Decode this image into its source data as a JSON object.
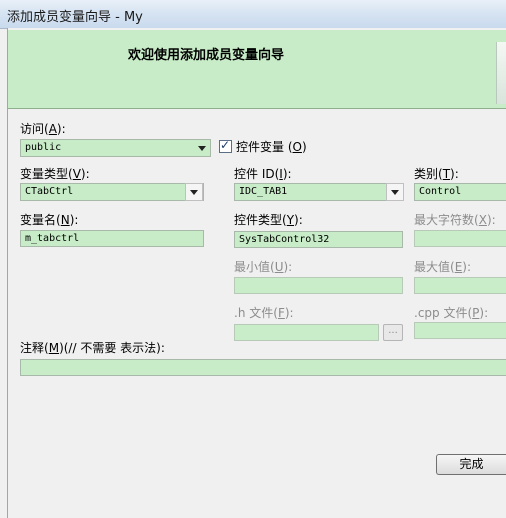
{
  "window": {
    "title": "添加成员变量向导 - My"
  },
  "banner": {
    "heading": "欢迎使用添加成员变量向导"
  },
  "access": {
    "label": "访问",
    "hotkey": "A",
    "value": "public"
  },
  "control_var": {
    "label": "控件变量",
    "hotkey": "O",
    "checked": true,
    "tick": "✓"
  },
  "var_type": {
    "label": "变量类型",
    "hotkey": "V",
    "value": "CTabCtrl"
  },
  "control_id": {
    "label": "控件 ID",
    "hotkey": "I",
    "value": "IDC_TAB1"
  },
  "category": {
    "label": "类别",
    "hotkey": "T",
    "value": "Control"
  },
  "var_name": {
    "label": "变量名",
    "hotkey": "N",
    "value": "m_tabctrl"
  },
  "control_type": {
    "label": "控件类型",
    "hotkey": "Y",
    "value": "SysTabControl32"
  },
  "max_chars": {
    "label": "最大字符数",
    "hotkey": "X",
    "value": ""
  },
  "min_value": {
    "label": "最小值",
    "hotkey": "U",
    "value": ""
  },
  "max_value": {
    "label": "最大值",
    "hotkey": "E",
    "value": ""
  },
  "h_file": {
    "label": ".h 文件",
    "hotkey": "F",
    "value": "",
    "browse": "..."
  },
  "cpp_file": {
    "label": ".cpp 文件",
    "hotkey": "P",
    "value": ""
  },
  "comment": {
    "label": "注释",
    "hotkey": "M",
    "suffix": "(// 不需要 表示法):",
    "value": ""
  },
  "buttons": {
    "finish": "完成"
  }
}
